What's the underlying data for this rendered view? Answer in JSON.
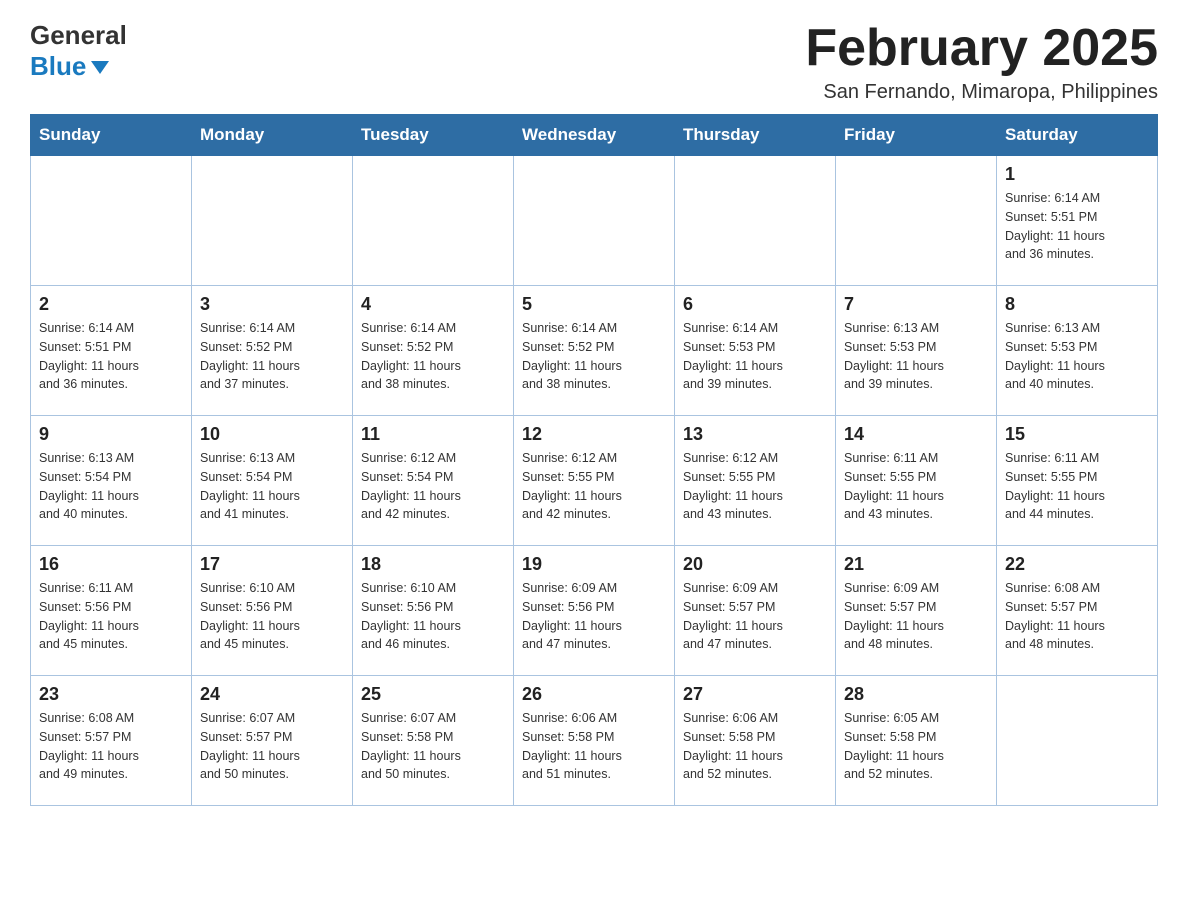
{
  "header": {
    "logo_general": "General",
    "logo_blue": "Blue",
    "month_title": "February 2025",
    "location": "San Fernando, Mimaropa, Philippines"
  },
  "weekdays": [
    "Sunday",
    "Monday",
    "Tuesday",
    "Wednesday",
    "Thursday",
    "Friday",
    "Saturday"
  ],
  "weeks": [
    [
      {
        "day": "",
        "info": ""
      },
      {
        "day": "",
        "info": ""
      },
      {
        "day": "",
        "info": ""
      },
      {
        "day": "",
        "info": ""
      },
      {
        "day": "",
        "info": ""
      },
      {
        "day": "",
        "info": ""
      },
      {
        "day": "1",
        "info": "Sunrise: 6:14 AM\nSunset: 5:51 PM\nDaylight: 11 hours\nand 36 minutes."
      }
    ],
    [
      {
        "day": "2",
        "info": "Sunrise: 6:14 AM\nSunset: 5:51 PM\nDaylight: 11 hours\nand 36 minutes."
      },
      {
        "day": "3",
        "info": "Sunrise: 6:14 AM\nSunset: 5:52 PM\nDaylight: 11 hours\nand 37 minutes."
      },
      {
        "day": "4",
        "info": "Sunrise: 6:14 AM\nSunset: 5:52 PM\nDaylight: 11 hours\nand 38 minutes."
      },
      {
        "day": "5",
        "info": "Sunrise: 6:14 AM\nSunset: 5:52 PM\nDaylight: 11 hours\nand 38 minutes."
      },
      {
        "day": "6",
        "info": "Sunrise: 6:14 AM\nSunset: 5:53 PM\nDaylight: 11 hours\nand 39 minutes."
      },
      {
        "day": "7",
        "info": "Sunrise: 6:13 AM\nSunset: 5:53 PM\nDaylight: 11 hours\nand 39 minutes."
      },
      {
        "day": "8",
        "info": "Sunrise: 6:13 AM\nSunset: 5:53 PM\nDaylight: 11 hours\nand 40 minutes."
      }
    ],
    [
      {
        "day": "9",
        "info": "Sunrise: 6:13 AM\nSunset: 5:54 PM\nDaylight: 11 hours\nand 40 minutes."
      },
      {
        "day": "10",
        "info": "Sunrise: 6:13 AM\nSunset: 5:54 PM\nDaylight: 11 hours\nand 41 minutes."
      },
      {
        "day": "11",
        "info": "Sunrise: 6:12 AM\nSunset: 5:54 PM\nDaylight: 11 hours\nand 42 minutes."
      },
      {
        "day": "12",
        "info": "Sunrise: 6:12 AM\nSunset: 5:55 PM\nDaylight: 11 hours\nand 42 minutes."
      },
      {
        "day": "13",
        "info": "Sunrise: 6:12 AM\nSunset: 5:55 PM\nDaylight: 11 hours\nand 43 minutes."
      },
      {
        "day": "14",
        "info": "Sunrise: 6:11 AM\nSunset: 5:55 PM\nDaylight: 11 hours\nand 43 minutes."
      },
      {
        "day": "15",
        "info": "Sunrise: 6:11 AM\nSunset: 5:55 PM\nDaylight: 11 hours\nand 44 minutes."
      }
    ],
    [
      {
        "day": "16",
        "info": "Sunrise: 6:11 AM\nSunset: 5:56 PM\nDaylight: 11 hours\nand 45 minutes."
      },
      {
        "day": "17",
        "info": "Sunrise: 6:10 AM\nSunset: 5:56 PM\nDaylight: 11 hours\nand 45 minutes."
      },
      {
        "day": "18",
        "info": "Sunrise: 6:10 AM\nSunset: 5:56 PM\nDaylight: 11 hours\nand 46 minutes."
      },
      {
        "day": "19",
        "info": "Sunrise: 6:09 AM\nSunset: 5:56 PM\nDaylight: 11 hours\nand 47 minutes."
      },
      {
        "day": "20",
        "info": "Sunrise: 6:09 AM\nSunset: 5:57 PM\nDaylight: 11 hours\nand 47 minutes."
      },
      {
        "day": "21",
        "info": "Sunrise: 6:09 AM\nSunset: 5:57 PM\nDaylight: 11 hours\nand 48 minutes."
      },
      {
        "day": "22",
        "info": "Sunrise: 6:08 AM\nSunset: 5:57 PM\nDaylight: 11 hours\nand 48 minutes."
      }
    ],
    [
      {
        "day": "23",
        "info": "Sunrise: 6:08 AM\nSunset: 5:57 PM\nDaylight: 11 hours\nand 49 minutes."
      },
      {
        "day": "24",
        "info": "Sunrise: 6:07 AM\nSunset: 5:57 PM\nDaylight: 11 hours\nand 50 minutes."
      },
      {
        "day": "25",
        "info": "Sunrise: 6:07 AM\nSunset: 5:58 PM\nDaylight: 11 hours\nand 50 minutes."
      },
      {
        "day": "26",
        "info": "Sunrise: 6:06 AM\nSunset: 5:58 PM\nDaylight: 11 hours\nand 51 minutes."
      },
      {
        "day": "27",
        "info": "Sunrise: 6:06 AM\nSunset: 5:58 PM\nDaylight: 11 hours\nand 52 minutes."
      },
      {
        "day": "28",
        "info": "Sunrise: 6:05 AM\nSunset: 5:58 PM\nDaylight: 11 hours\nand 52 minutes."
      },
      {
        "day": "",
        "info": ""
      }
    ]
  ]
}
